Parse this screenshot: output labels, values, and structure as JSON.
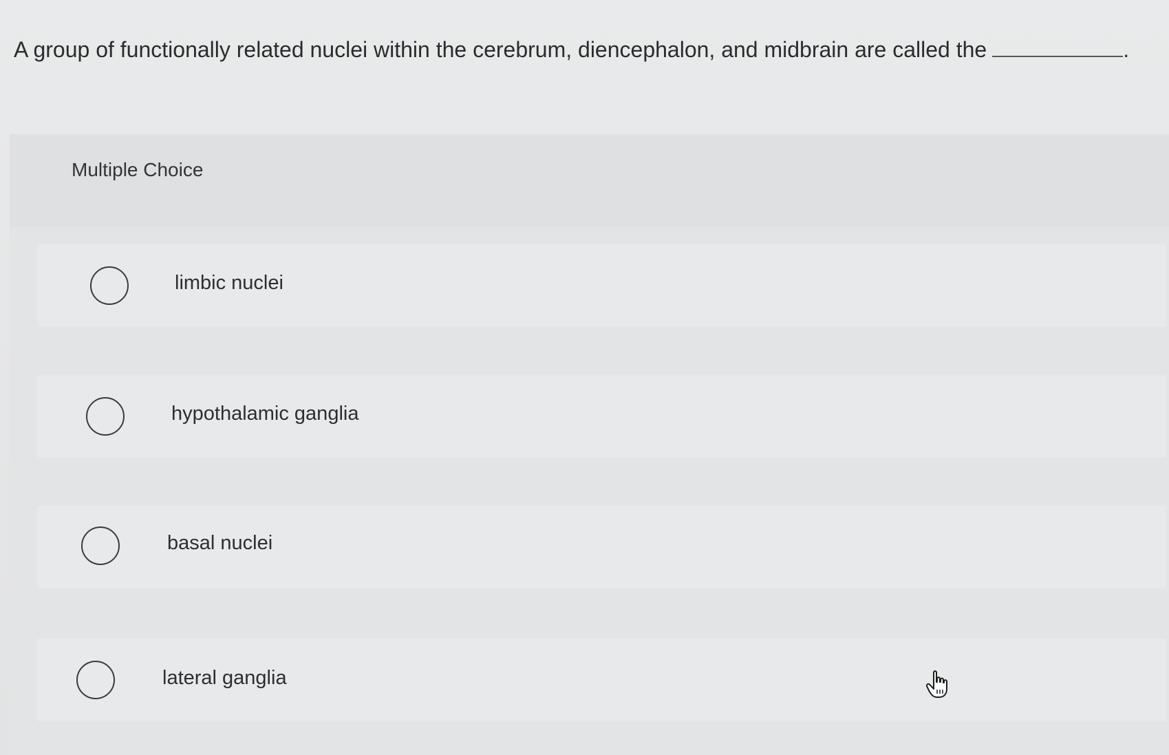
{
  "question": {
    "text": "A group of functionally related nuclei within the cerebrum, diencephalon, and midbrain are called the",
    "end_punct": "."
  },
  "section_label": "Multiple Choice",
  "options": [
    {
      "label": "limbic nuclei",
      "selected": false
    },
    {
      "label": "hypothalamic ganglia",
      "selected": false
    },
    {
      "label": "basal nuclei",
      "selected": false
    },
    {
      "label": "lateral ganglia",
      "selected": false
    }
  ],
  "cursor_icon": "hand-pointer-icon"
}
